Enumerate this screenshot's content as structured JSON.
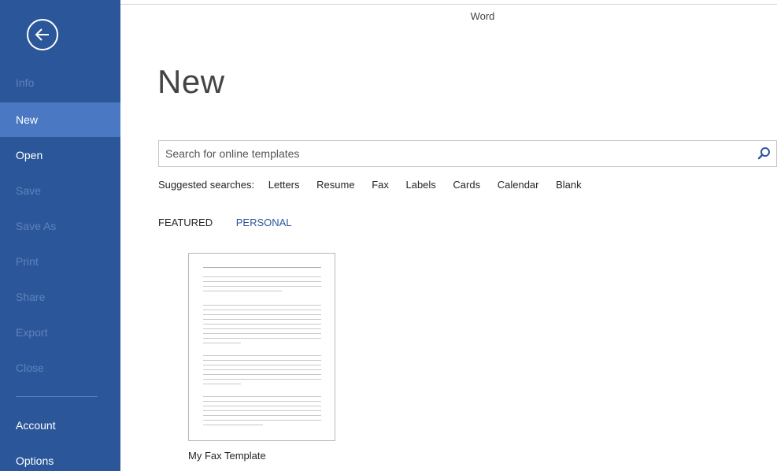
{
  "window": {
    "title": "Word"
  },
  "sidebar": {
    "back_icon": "back-arrow-icon",
    "items": [
      {
        "label": "Info",
        "state": "disabled"
      },
      {
        "label": "New",
        "state": "selected"
      },
      {
        "label": "Open",
        "state": "enabled"
      },
      {
        "label": "Save",
        "state": "disabled"
      },
      {
        "label": "Save As",
        "state": "disabled"
      },
      {
        "label": "Print",
        "state": "disabled"
      },
      {
        "label": "Share",
        "state": "disabled"
      },
      {
        "label": "Export",
        "state": "disabled"
      },
      {
        "label": "Close",
        "state": "disabled"
      },
      {
        "label": "Account",
        "state": "enabled"
      },
      {
        "label": "Options",
        "state": "enabled"
      }
    ],
    "colors": {
      "background": "#2b579a",
      "selected": "#4a78c2"
    }
  },
  "main": {
    "page_title": "New",
    "search": {
      "placeholder": "Search for online templates",
      "value": "",
      "icon": "search-icon"
    },
    "suggested": {
      "label": "Suggested searches:",
      "links": [
        "Letters",
        "Resume",
        "Fax",
        "Labels",
        "Cards",
        "Calendar",
        "Blank"
      ]
    },
    "tabs": [
      {
        "label": "FEATURED",
        "active": false
      },
      {
        "label": "PERSONAL",
        "active": true
      }
    ],
    "templates": [
      {
        "name": "My Fax Template"
      }
    ]
  }
}
